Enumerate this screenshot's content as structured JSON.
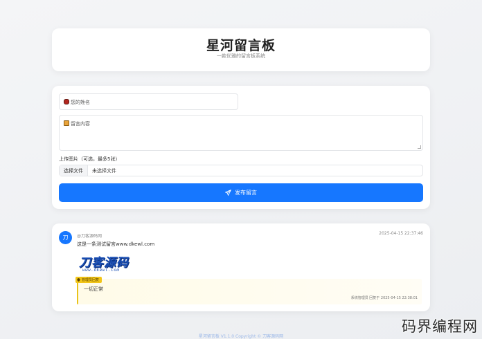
{
  "header": {
    "title": "星河留言板",
    "subtitle": "一款优雅的留言板系统"
  },
  "form": {
    "name_placeholder": "您的姓名",
    "name_icon": "name-badge-icon",
    "message_placeholder": "留言内容",
    "message_icon": "memo-icon",
    "upload_label": "上传图片（可选，最多5张）",
    "file_button": "选择文件",
    "file_status": "未选择文件",
    "submit_label": "发布留言",
    "submit_icon": "paper-plane-icon",
    "accent_color": "#1677ff"
  },
  "messages": [
    {
      "avatar_letter": "刀",
      "author": "@刀客源码网",
      "time": "2025-04-15 22:37:46",
      "text": "这是一条测试留言www.dkewl.com",
      "image": {
        "logo_text": "刀客源码",
        "logo_sub": "www.dkewl.com"
      },
      "reply": {
        "badge": "管理员回复",
        "text": "一切正常",
        "meta": "系统管理员 回复于 2025-04-15 22:38:01",
        "accent_color": "#e9c31a"
      }
    }
  ],
  "footer": {
    "text": "星河留言板 V1.1.0 Copyright © 刀客源码网"
  },
  "watermark": "码界编程网"
}
